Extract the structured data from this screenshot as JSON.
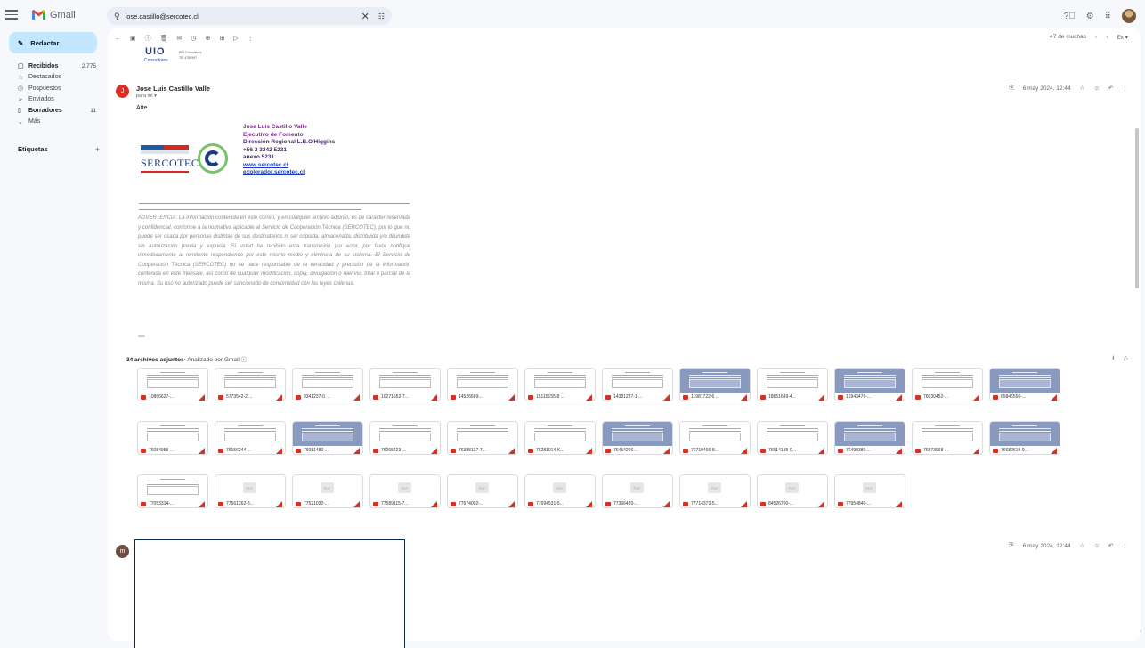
{
  "app": {
    "name": "Gmail"
  },
  "search": {
    "query": "jose.castillo@sercotec.cl"
  },
  "compose": {
    "label": "Redactar"
  },
  "sidebar": {
    "items": [
      {
        "icon": "inbox-icon",
        "glyph": "▢",
        "label": "Recibidos",
        "count": "2.775",
        "bold": true
      },
      {
        "icon": "star-icon",
        "glyph": "☆",
        "label": "Destacados",
        "count": "",
        "bold": false
      },
      {
        "icon": "clock-icon",
        "glyph": "◷",
        "label": "Pospuestos",
        "count": "",
        "bold": false
      },
      {
        "icon": "send-icon",
        "glyph": "➢",
        "label": "Enviados",
        "count": "",
        "bold": false
      },
      {
        "icon": "draft-icon",
        "glyph": "▯",
        "label": "Borradores",
        "count": "11",
        "bold": true
      },
      {
        "icon": "chevron-down-icon",
        "glyph": "⌄",
        "label": "Más",
        "count": "",
        "bold": false
      }
    ],
    "labels_title": "Etiquetas"
  },
  "pager": {
    "text": "47 de muchas"
  },
  "previous_signature": {
    "logo_text": "UIO",
    "caption": "Consultores",
    "tiny_text": "PRI Consultores\nTE: 4756997"
  },
  "message1": {
    "avatar": "J",
    "sender": "Jose Luis Castillo Valle",
    "to": "para mí",
    "date": "6 may 2024, 12:44",
    "body": "Atte.",
    "signature": {
      "logo_word": "SERCOTEC",
      "name": "Jose Luis Castillo Valle",
      "role": "Ejecutivo de Fomento",
      "office": "Dirección Regional L.B.O'Higgins",
      "phone": "+56 2 3242 5231",
      "ext": "anexo 5231",
      "link1": "www.sercotec.cl",
      "link2": "explorador.sercotec.cl"
    },
    "disclaimer": "ADVERTENCIA: La información contenida en este correo, y en cualquier archivo adjunto, es de carácter reservada y confidencial, conforme a la normativa aplicable al Servicio de Cooperación Técnica (SERCOTEC), por lo que no puede ser usada por personas distintas de sus destinatarios ni ser copiada, almacenada, distribuida y/o difundida sin autorización previa y expresa. Si usted ha recibido esta transmisión por error, por favor notifique inmediatamente al remitente respondiendo por este mismo medio y elimínela de su sistema. El Servicio de Cooperación Técnica (SERCOTEC) no se hace responsable de la veracidad y precisión de la información contenida en este mensaje, así como de cualquier modificación, copia, divulgación o reenvío, total o parcial de la misma. Su uso no autorizado puede ser sancionado de conformidad con las leyes chilenas."
  },
  "attachments": {
    "heading": "34 archivos adjuntos",
    "scanned": "Analizado por Gmail",
    "files": [
      {
        "name": "10866627-...",
        "style": "doc"
      },
      {
        "name": "5773542-2 ...",
        "style": "doc"
      },
      {
        "name": "9341237-0 ...",
        "style": "doc"
      },
      {
        "name": "10271552-7...",
        "style": "doc"
      },
      {
        "name": "14526689-...",
        "style": "doc"
      },
      {
        "name": "15115155-8 ...",
        "style": "doc"
      },
      {
        "name": "14381287-1 ...",
        "style": "doc"
      },
      {
        "name": "11981722-6 ...",
        "style": "blue"
      },
      {
        "name": "18651649-4...",
        "style": "doc"
      },
      {
        "name": "16943476-...",
        "style": "blue"
      },
      {
        "name": "76030452-...",
        "style": "doc"
      },
      {
        "name": "65846550-...",
        "style": "blue"
      },
      {
        "name": "76084955-...",
        "style": "doc"
      },
      {
        "name": "76156244-...",
        "style": "doc"
      },
      {
        "name": "76081480-...",
        "style": "blue"
      },
      {
        "name": "76265423-...",
        "style": "doc"
      },
      {
        "name": "76388137-7...",
        "style": "doc"
      },
      {
        "name": "76281014-K...",
        "style": "doc"
      },
      {
        "name": "76454266-...",
        "style": "blue"
      },
      {
        "name": "76719466-8...",
        "style": "doc"
      },
      {
        "name": "76514185-0...",
        "style": "doc"
      },
      {
        "name": "76490389-...",
        "style": "blue"
      },
      {
        "name": "76873968-...",
        "style": "doc"
      },
      {
        "name": "76682619-9...",
        "style": "blue"
      },
      {
        "name": "77053314-...",
        "style": "doc"
      },
      {
        "name": "77561262-3...",
        "style": "blank"
      },
      {
        "name": "77521032-...",
        "style": "blank"
      },
      {
        "name": "77589115-7...",
        "style": "blank"
      },
      {
        "name": "77674002-...",
        "style": "blank"
      },
      {
        "name": "77694531-5...",
        "style": "blank"
      },
      {
        "name": "77366420-...",
        "style": "blank"
      },
      {
        "name": "77714373-5...",
        "style": "blank"
      },
      {
        "name": "84526700-...",
        "style": "blank"
      },
      {
        "name": "77954840-...",
        "style": "blank"
      }
    ]
  },
  "message2": {
    "avatar": "m",
    "date": "6 may 2024, 12:44"
  },
  "colors": {
    "compose_bg": "#c2e7ff",
    "pdf_red": "#d93025",
    "brand_purple": "#7d2b8b",
    "link_blue": "#1a3bbf"
  }
}
